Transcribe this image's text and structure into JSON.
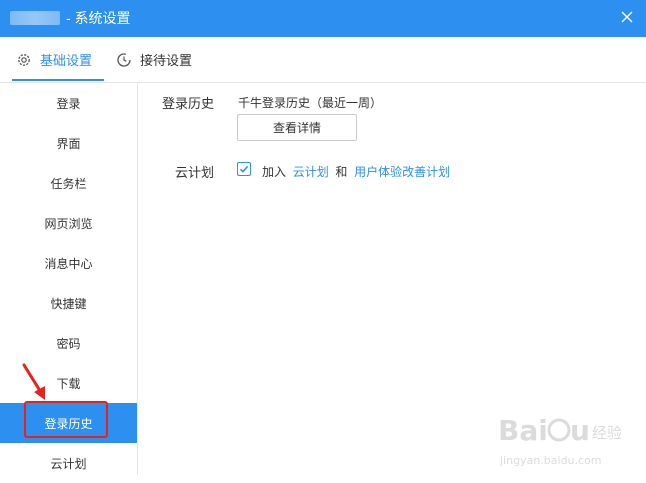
{
  "window": {
    "title": "- 系统设置",
    "close_icon": "close-icon"
  },
  "tabs": [
    {
      "label": "基础设置",
      "icon": "gear-icon",
      "active": true
    },
    {
      "label": "接待设置",
      "icon": "clock-icon",
      "active": false
    }
  ],
  "sidebar": {
    "items": [
      {
        "label": "登录"
      },
      {
        "label": "界面"
      },
      {
        "label": "任务栏"
      },
      {
        "label": "网页浏览"
      },
      {
        "label": "消息中心"
      },
      {
        "label": "快捷键"
      },
      {
        "label": "密码"
      },
      {
        "label": "下载"
      },
      {
        "label": "登录历史",
        "active": true
      },
      {
        "label": "云计划"
      }
    ]
  },
  "login_history": {
    "label": "登录历史",
    "description": "千牛登录历史（最近一周）",
    "button_label": "查看详情"
  },
  "cloud_plan": {
    "label": "云计划",
    "checked": true,
    "join_text": "加入",
    "link1": "云计划",
    "and_text": "和",
    "link2": "用户体验改善计划"
  },
  "watermark": {
    "brand": "Baidu经验",
    "url": "jingyan.baidu.com"
  },
  "colors": {
    "accent": "#2d8ff0",
    "highlight_red": "#e8221b"
  }
}
